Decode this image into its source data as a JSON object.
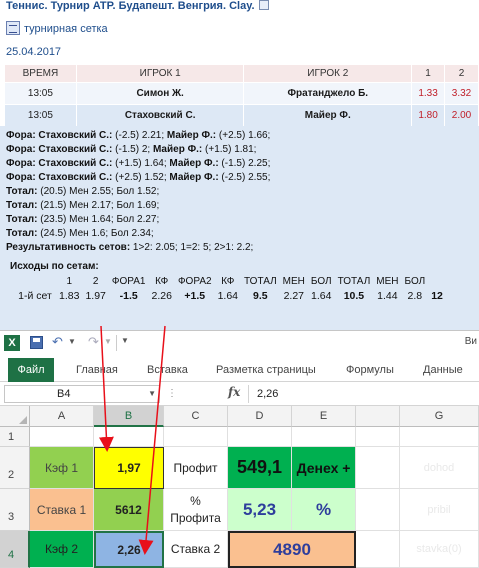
{
  "page": {
    "title": "Теннис. Турнир ATP. Будапешт. Венгрия. Clay.",
    "grid_link": "турнирная сетка",
    "date": "25.04.2017"
  },
  "matches": {
    "headers": [
      "ВРЕМЯ",
      "ИГРОК 1",
      "ИГРОК 2",
      "1",
      "2"
    ],
    "rows": [
      {
        "time": "13:05",
        "p1": "Симон Ж.",
        "p2": "Фратанджело Б.",
        "o1": "1.33",
        "o2": "3.32"
      },
      {
        "time": "13:05",
        "p1": "Стаховский С.",
        "p2": "Майер Ф.",
        "o1": "1.80",
        "o2": "2.00"
      }
    ]
  },
  "bets": {
    "lines": [
      {
        "label": "Фора: Стаховский С.:",
        "text": " (-2.5) 2.21; ",
        "label2": "Майер Ф.:",
        "text2": " (+2.5) 1.66;"
      },
      {
        "label": "Фора: Стаховский С.:",
        "text": " (-1.5) 2; ",
        "label2": "Майер Ф.:",
        "text2": " (+1.5) 1.81;"
      },
      {
        "label": "Фора: Стаховский С.:",
        "text": " (+1.5) 1.64; ",
        "label2": "Майер Ф.:",
        "text2": " (-1.5) 2.25;"
      },
      {
        "label": "Фора: Стаховский С.:",
        "text": " (+2.5) 1.52; ",
        "label2": "Майер Ф.:",
        "text2": " (-2.5) 2.55;"
      },
      {
        "label": "Тотал:",
        "text": " (20.5) Мен 2.55; Бол 1.52;",
        "label2": "",
        "text2": ""
      },
      {
        "label": "Тотал:",
        "text": " (21.5) Мен 2.17; Бол 1.69;",
        "label2": "",
        "text2": ""
      },
      {
        "label": "Тотал:",
        "text": " (23.5) Мен 1.64; Бол 2.27;",
        "label2": "",
        "text2": ""
      },
      {
        "label": "Тотал:",
        "text": " (24.5) Мен 1.6; Бол 2.34;",
        "label2": "",
        "text2": ""
      },
      {
        "label": "Результативность сетов:",
        "text": " 1>2: 2.05; 1=2: 5; 2>1: 2.2;",
        "label2": "",
        "text2": ""
      }
    ],
    "ishody_title": "Исходы по сетам:",
    "sets_headers": [
      "",
      "1",
      "2",
      "ФОРА1",
      "КФ",
      "ФОРА2",
      "КФ",
      "ТОТАЛ",
      "МЕН",
      "БОЛ",
      "ТОТАЛ",
      "МЕН",
      "БОЛ"
    ],
    "sets_row": [
      "1-й сет",
      "1.83",
      "1.97",
      "-1.5",
      "2.26",
      "+1.5",
      "1.64",
      "9.5",
      "2.27",
      "1.64",
      "10.5",
      "1.44",
      "2.8",
      "12"
    ]
  },
  "excel": {
    "app_icon": "X",
    "title_tail": "Ви",
    "tabs": [
      "Файл",
      "Главная",
      "Вставка",
      "Разметка страницы",
      "Формулы",
      "Данные"
    ],
    "namebox": "B4",
    "fx": "fx",
    "formula_value": "2,26",
    "columns": [
      "A",
      "B",
      "C",
      "D",
      "E",
      "G"
    ],
    "rows": [
      "1",
      "2",
      "3",
      "4"
    ],
    "cells": {
      "a2": "Кэф 1",
      "b2": "1,97",
      "c2": "Профит",
      "d2": "549,1",
      "e2": "Денех +",
      "g2": "dohod",
      "a3": "Ставка 1",
      "b3": "5612",
      "c3": "% Профита",
      "d3": "5,23",
      "e3": "%",
      "g3": "pribil",
      "a4": "Кэф 2",
      "b4": "2,26",
      "c4": "Ставка 2",
      "d4": "4890",
      "g4": "stavka(0)"
    },
    "colors": {
      "excel_green": "#1e7145",
      "green_cell": "#00b050",
      "light_green": "#92d050",
      "yellow": "#ffff00",
      "peach": "#fac090",
      "mint": "#ccffcc",
      "arrow_red": "#e8101a",
      "number_blue": "#2e3e9c"
    }
  }
}
